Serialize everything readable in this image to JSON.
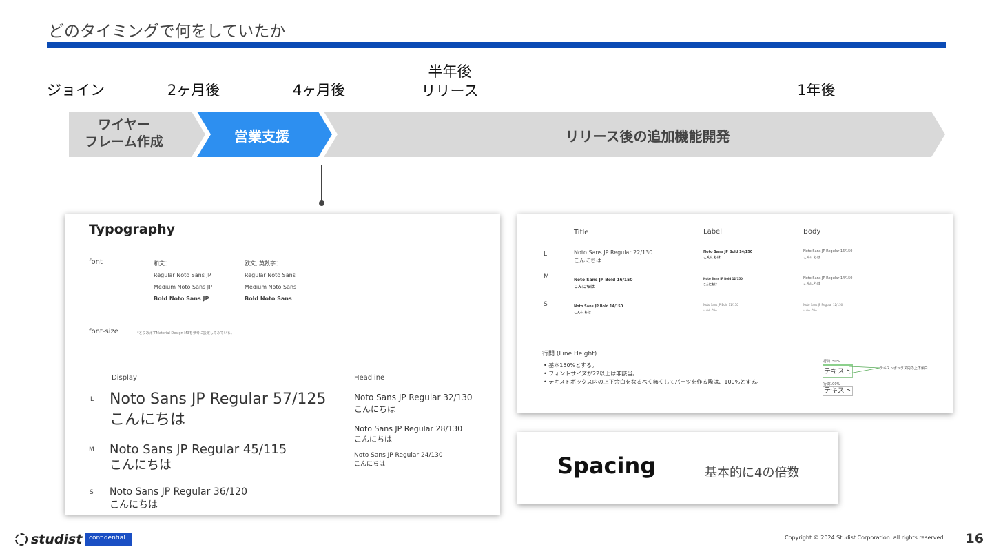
{
  "page": {
    "title": "どのタイミングで何をしていたか",
    "page_number": "16"
  },
  "milestones": [
    {
      "label": "ジョイン"
    },
    {
      "label": "2ヶ月後"
    },
    {
      "label": "4ヶ月後"
    },
    {
      "label_line1": "半年後",
      "label_line2": "リリース"
    },
    {
      "label": "1年後"
    }
  ],
  "phases": [
    {
      "line1": "ワイヤー",
      "line2": "フレーム作成",
      "color": "#d9d9d9"
    },
    {
      "label": "営業支援",
      "color": "#2d8ff0"
    },
    {
      "label": "リリース後の追加機能開発",
      "color": "#d9d9d9"
    }
  ],
  "typography_slide": {
    "heading": "Typography",
    "font_label": "font",
    "wabun_header": "和文：",
    "wabun_regular": "Regular Noto Sans JP",
    "wabun_medium": "Medium Noto Sans JP",
    "wabun_bold": "Bold Noto Sans JP",
    "obun_header": "欧文, 英数字：",
    "obun_regular": "Regular Noto Sans",
    "obun_medium": "Medium Noto Sans",
    "obun_bold": "Bold Noto Sans",
    "fontsize_label": "font-size",
    "fontsize_note": "*とりあえずMaterial Design M3を参考に設定してみている。",
    "display_label": "Display",
    "headline_label": "Headline",
    "size_l": "L",
    "size_m": "M",
    "size_s": "S",
    "display_l": "Noto Sans JP Regular 57/125",
    "display_m": "Noto Sans JP Regular 45/115",
    "display_s": "Noto Sans JP Regular 36/120",
    "headline_1": "Noto Sans JP Regular 32/130",
    "headline_2": "Noto Sans JP Regular 28/130",
    "headline_3": "Noto Sans JP Regular 24/130",
    "sample": "こんにちは"
  },
  "type_table_slide": {
    "col_title": "Title",
    "col_label": "Label",
    "col_body": "Body",
    "row_l": "L",
    "row_m": "M",
    "row_s": "S",
    "title_l": "Noto Sans JP Regular 22/130",
    "title_m": "Noto Sans JP Bold 16/150",
    "title_s": "Noto Sans JP Bold 14/150",
    "label_l": "Noto Sans JP Bold 14/150",
    "label_m": "Noto Sans JP Bold 12/150",
    "label_s": "Noto Sans JP Bold 11/150",
    "body_l": "Noto Sans JP Regular 16/150",
    "body_m": "Noto Sans JP Regular 14/150",
    "body_s": "Noto Sans JP Regular 12/150",
    "sample": "こんにちは",
    "line_height_title": "行間 (Line Height)",
    "bullet_1": "基本150%とする。",
    "bullet_2": "フォントサイズが22以上は非該当。",
    "bullet_3": "テキストボックス内の上下余白をなるべく無くしてパーツを作る際は、100%とする。",
    "lh150_label": "行間150%",
    "lh100_label": "行間100%",
    "sample_text": "テキスト",
    "margin_note": "テキストボックス内の上下余白"
  },
  "spacing_slide": {
    "heading": "Spacing",
    "note": "基本的に4の倍数"
  },
  "footer": {
    "brand": "studist",
    "confidential": "confidential",
    "copyright": "Copyright © 2024 Studist Corporation. all rights reserved."
  }
}
